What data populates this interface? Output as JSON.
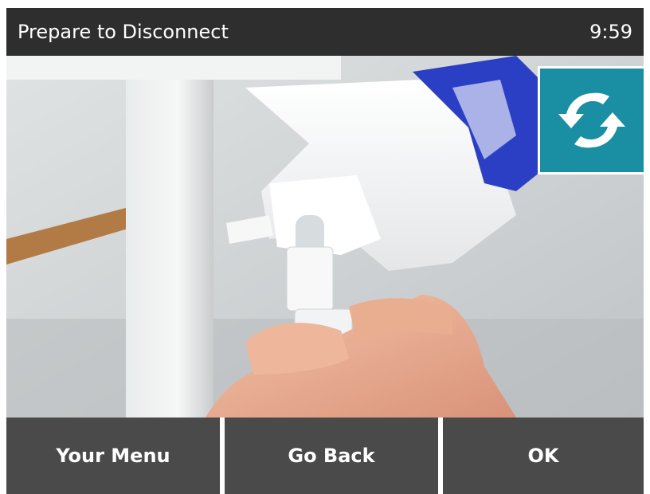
{
  "header": {
    "title": "Prepare to Disconnect",
    "time": "9:59"
  },
  "illustration": {
    "subject": "hand-holding-connector"
  },
  "refresh_button": {
    "icon": "refresh-icon",
    "color": "#1a8fa3"
  },
  "footer": {
    "menu_label": "Your Menu",
    "back_label": "Go Back",
    "ok_label": "OK"
  },
  "colors": {
    "header_bg": "#2e2e2e",
    "button_bg": "#4a4a4a",
    "accent": "#1a8fa3",
    "blue_part": "#2b3fc4"
  }
}
